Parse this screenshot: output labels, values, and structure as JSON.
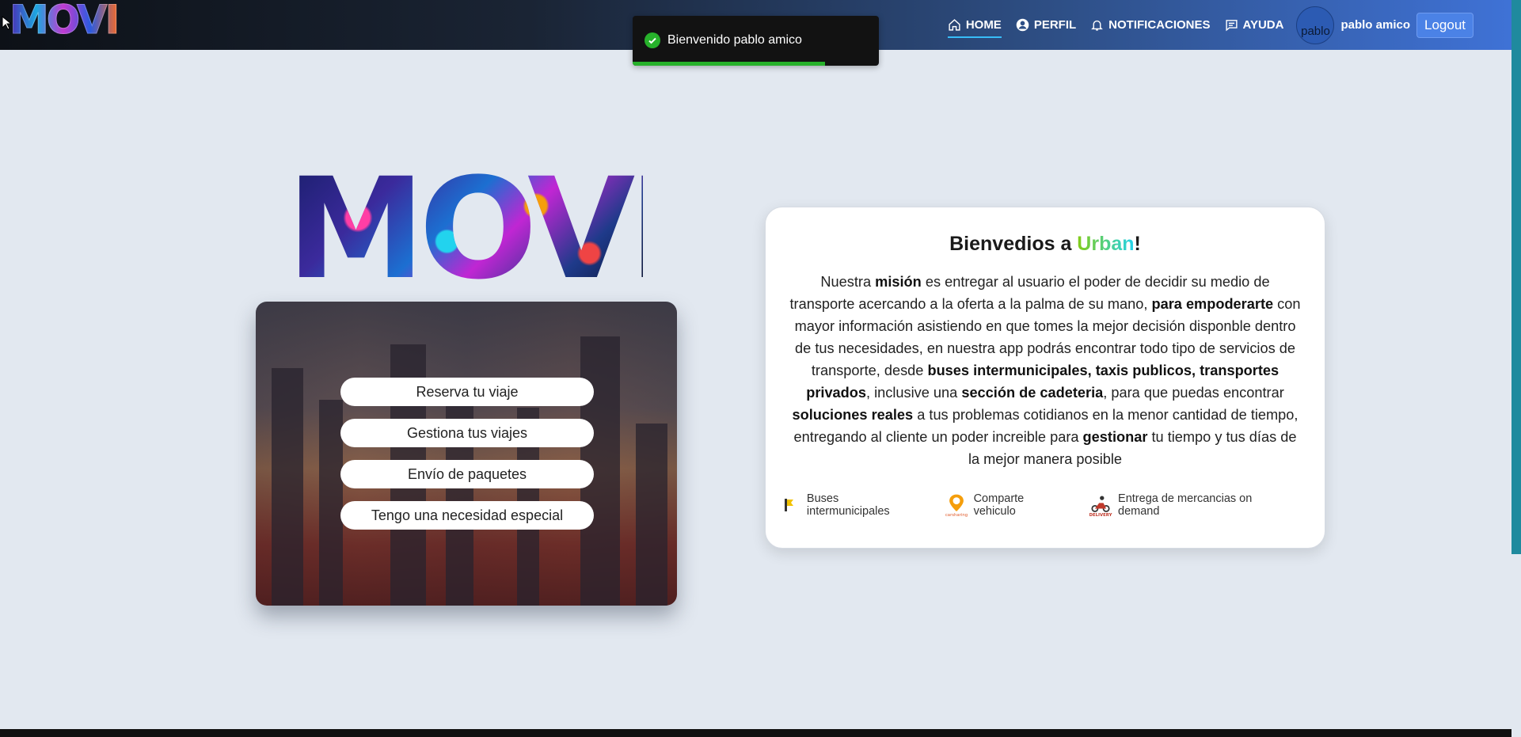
{
  "navbar": {
    "logo_text": "MOVI",
    "links": [
      {
        "label": "HOME",
        "icon": "home-icon",
        "active": true
      },
      {
        "label": "PERFIL",
        "icon": "user-icon",
        "active": false
      },
      {
        "label": "NOTIFICACIONES",
        "icon": "bell-icon",
        "active": false
      },
      {
        "label": "AYUDA",
        "icon": "chat-icon",
        "active": false
      }
    ],
    "avatar_alt": "pablo",
    "user_name": "pablo amico",
    "logout_label": "Logout"
  },
  "toast": {
    "message": "Bienvenido pablo amico",
    "icon": "check-circle-icon",
    "progress": 0.78,
    "color": "#27b12b"
  },
  "hero": {
    "logo_text": "MOVI"
  },
  "menu": {
    "items": [
      "Reserva tu viaje",
      "Gestiona tus viajes",
      "Envío de paquetes",
      "Tengo una necesidad especial"
    ]
  },
  "info": {
    "title_prefix": "Bienvedios a ",
    "title_brand": "Urban",
    "title_suffix": "!",
    "body": [
      {
        "t": "Nuestra ",
        "b": false
      },
      {
        "t": "misión",
        "b": true
      },
      {
        "t": " es entregar al usuario el poder de decidir su medio de transporte acercando a la oferta a la palma de su mano, ",
        "b": false
      },
      {
        "t": "para empoderarte",
        "b": true
      },
      {
        "t": " con mayor información asistiendo en que tomes la mejor decisión disponble dentro de tus necesidades, en nuestra app podrás encontrar todo tipo de servicios de transporte, desde ",
        "b": false
      },
      {
        "t": "buses intermunicipales, taxis publicos, transportes privados",
        "b": true
      },
      {
        "t": ", inclusive una ",
        "b": false
      },
      {
        "t": "sección de cadeteria",
        "b": true
      },
      {
        "t": ", para que puedas encontrar ",
        "b": false
      },
      {
        "t": "soluciones reales",
        "b": true
      },
      {
        "t": " a tus problemas cotidianos en la menor cantidad de tiempo, entregando al cliente un poder increible para ",
        "b": false
      },
      {
        "t": "gestionar",
        "b": true
      },
      {
        "t": " tu tiempo y tus días de la mejor manera posible",
        "b": false
      }
    ],
    "services": [
      {
        "label": "Buses intermunicipales",
        "icon": "bus-icon"
      },
      {
        "label": "Comparte vehiculo",
        "icon": "carsharing-icon",
        "icon_text": "carsharing"
      },
      {
        "label": "Entrega de mercancias on demand",
        "icon": "delivery-icon",
        "icon_text": "DELIVERY"
      }
    ]
  },
  "colors": {
    "page_bg": "#e2e8f0",
    "brand_green": "#84cc16",
    "brand_cyan": "#22d3ee",
    "logout_bg": "#4b82e6"
  }
}
